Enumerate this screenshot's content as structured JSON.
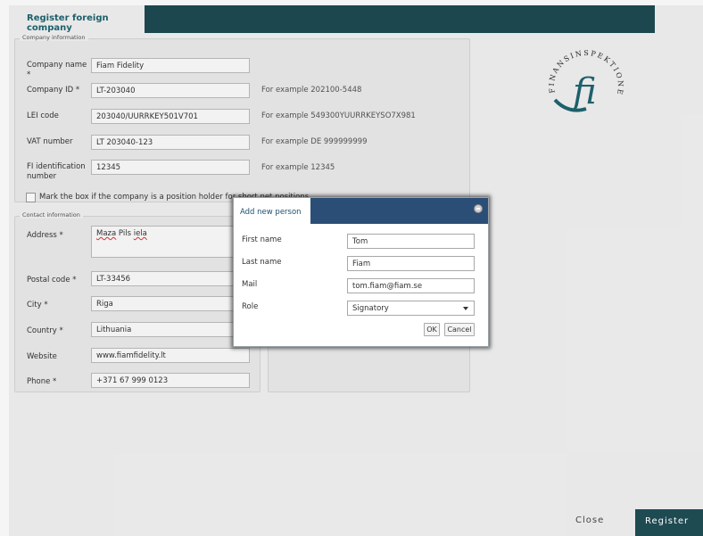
{
  "tabs": {
    "active": "Register foreign company"
  },
  "company_info": {
    "legend": "Company information",
    "fields": [
      {
        "label": "Company name *",
        "value": "Fiam Fidelity",
        "hint": ""
      },
      {
        "label": "Company ID *",
        "value": "LT-203040",
        "hint": "For example 202100-5448"
      },
      {
        "label": "LEI code",
        "value": "203040/UURRKEY501V701",
        "hint": "For example 549300YUURRKEYSO7X981"
      },
      {
        "label": "VAT number",
        "value": "LT 203040-123",
        "hint": "For example DE 999999999"
      },
      {
        "label": "FI identification number",
        "value": "12345",
        "hint": "For example 12345"
      }
    ],
    "checkbox_label": "Mark the box if the company is a position holder for short net positions"
  },
  "contact_info": {
    "legend": "Contact information",
    "address_label": "Address *",
    "address_value_1": "Maza",
    "address_value_2": "Pils",
    "address_value_3": "iela",
    "postal_label": "Postal code *",
    "postal_value": "LT-33456",
    "city_label": "City *",
    "city_value": "Riga",
    "country_label": "Country *",
    "country_value": "Lithuania",
    "website_label": "Website",
    "website_value": "www.fiamfidelity.lt",
    "phone_label": "Phone *",
    "phone_value": "+371 67 999 0123"
  },
  "modal": {
    "title": "Add new person",
    "first_name_label": "First name",
    "first_name_value": "Tom",
    "last_name_label": "Last name",
    "last_name_value": "Fiam",
    "mail_label": "Mail",
    "mail_value": "tom.fiam@fiam.se",
    "role_label": "Role",
    "role_value": "Signatory",
    "ok_label": "OK",
    "cancel_label": "Cancel"
  },
  "footer": {
    "close_label": "Close",
    "register_label": "Register"
  },
  "logo": {
    "ring_text": "FINANSINSPEKTIONEN",
    "mark": "fi"
  },
  "colors": {
    "accent": "#1e4a52",
    "modal_header": "#2b4e77",
    "background": "#f2f2f2"
  }
}
